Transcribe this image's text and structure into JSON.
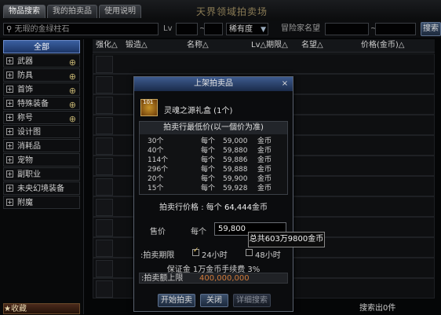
{
  "header": {
    "tabs": [
      {
        "label": "物品搜索"
      },
      {
        "label": "我的拍卖品"
      },
      {
        "label": "使用说明"
      }
    ],
    "title": "天界领域拍卖场"
  },
  "search": {
    "keyword": "无瑕的金绿柱石",
    "lv_label": "Lv",
    "lv_sep": "~",
    "rarity": "稀有度",
    "seller_label": "冒险家名望",
    "seller_sep": "~",
    "search_button": "搜索"
  },
  "sidebar": {
    "all": "全部",
    "items": [
      {
        "label": "武器",
        "mag": true
      },
      {
        "label": "防具",
        "mag": true
      },
      {
        "label": "首饰",
        "mag": true
      },
      {
        "label": "特殊装备",
        "mag": true
      },
      {
        "label": "称号",
        "mag": true
      },
      {
        "label": "设计图",
        "mag": false
      },
      {
        "label": "消耗品",
        "mag": false
      },
      {
        "label": "宠物",
        "mag": false
      },
      {
        "label": "副职业",
        "mag": false
      },
      {
        "label": "未央幻境装备",
        "mag": false
      },
      {
        "label": "附魔",
        "mag": false
      }
    ],
    "bottom_tab": "★收藏"
  },
  "table": {
    "columns": [
      "强化△",
      "锻造△",
      "名称△",
      "Lv△期限△",
      "名望△",
      "价格(金币)△"
    ],
    "result_count": "搜索出0件"
  },
  "dialog": {
    "title": "上架拍卖品",
    "close": "×",
    "item_level": "101",
    "item_name": "灵魂之源礼盒 (1个)",
    "price_header": "拍卖行最低价(以一個价为准)",
    "prices": [
      {
        "qty": "30个",
        "unit": "每个",
        "price": "59,000",
        "currency": "金币"
      },
      {
        "qty": "40个",
        "unit": "每个",
        "price": "59,880",
        "currency": "金币"
      },
      {
        "qty": "114个",
        "unit": "每个",
        "price": "59,886",
        "currency": "金币"
      },
      {
        "qty": "296个",
        "unit": "每个",
        "price": "59,888",
        "currency": "金币"
      },
      {
        "qty": "20个",
        "unit": "每个",
        "price": "59,900",
        "currency": "金币"
      },
      {
        "qty": "15个",
        "unit": "每个",
        "price": "59,928",
        "currency": "金币"
      }
    ],
    "ref_price_label": "拍卖行价格 : 每个",
    "ref_price_value": "64,444",
    "ref_price_unit": "金币",
    "sell_label": "售价",
    "per_label": "每个",
    "price_input": "59,800",
    "tooltip": "总共603万9800金币",
    "duration_label": ":拍卖期限",
    "dur_24": "24小时",
    "dur_24_checked": true,
    "dur_48": "48小时",
    "dur_48_checked": false,
    "deposit": "保证金  1万金币手续费  3%",
    "cap_label": ":拍卖额上限",
    "cap_value": "400,000,000",
    "buttons": {
      "start": "开始拍卖",
      "close": "关闭",
      "detail": "详细搜索"
    }
  }
}
